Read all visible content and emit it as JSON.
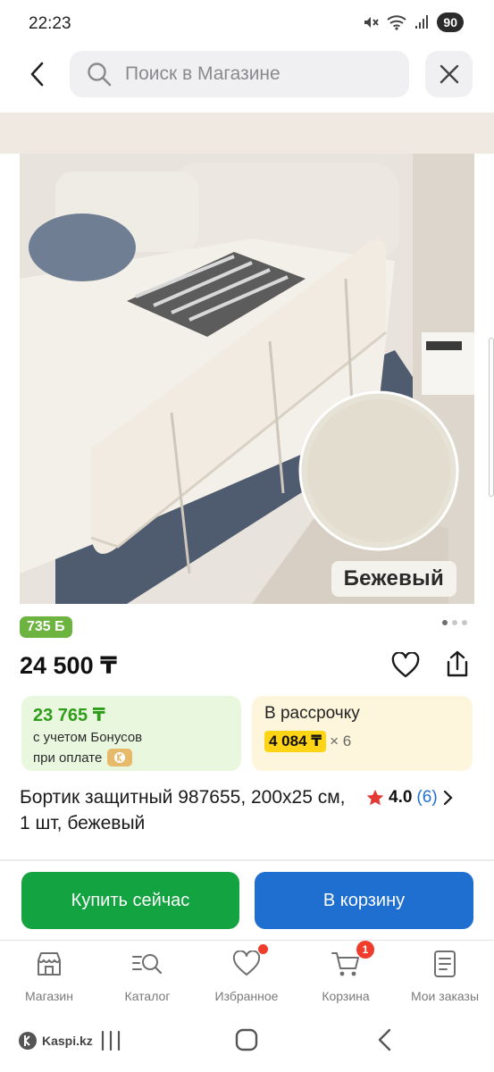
{
  "status_bar": {
    "time": "22:23",
    "battery": "90"
  },
  "search": {
    "placeholder": "Поиск в Магазине"
  },
  "product": {
    "image_color_tag": "Бежевый",
    "bonus_badge": "735 Б",
    "price": "24 500 ₸",
    "bonus_price": "23 765 ₸",
    "bonus_line1": "с учетом Бонусов",
    "bonus_line2": "при оплате",
    "installment_label": "В рассрочку",
    "installment_amount": "4 084 ₸",
    "installment_months": "× 6",
    "title": "Бортик защитный 987655, 200x25 см, 1 шт, бежевый",
    "rating_value": "4.0",
    "rating_count": "(6)"
  },
  "actions": {
    "buy_now": "Купить сейчас",
    "add_to_cart": "В корзину"
  },
  "bottom_nav": {
    "items": [
      {
        "label": "Магазин",
        "icon": "store-icon"
      },
      {
        "label": "Каталог",
        "icon": "catalog-search-icon"
      },
      {
        "label": "Избранное",
        "icon": "heart-icon"
      },
      {
        "label": "Корзина",
        "icon": "cart-icon",
        "badge": "1"
      },
      {
        "label": "Мои заказы",
        "icon": "orders-icon"
      }
    ]
  },
  "system_nav": {
    "brand": "Kaspi.kz"
  },
  "colors": {
    "green": "#14a341",
    "blue": "#1f6fd1",
    "bonus_green": "#6cb33f",
    "yellow": "#fed417",
    "red": "#ef3c2d"
  }
}
